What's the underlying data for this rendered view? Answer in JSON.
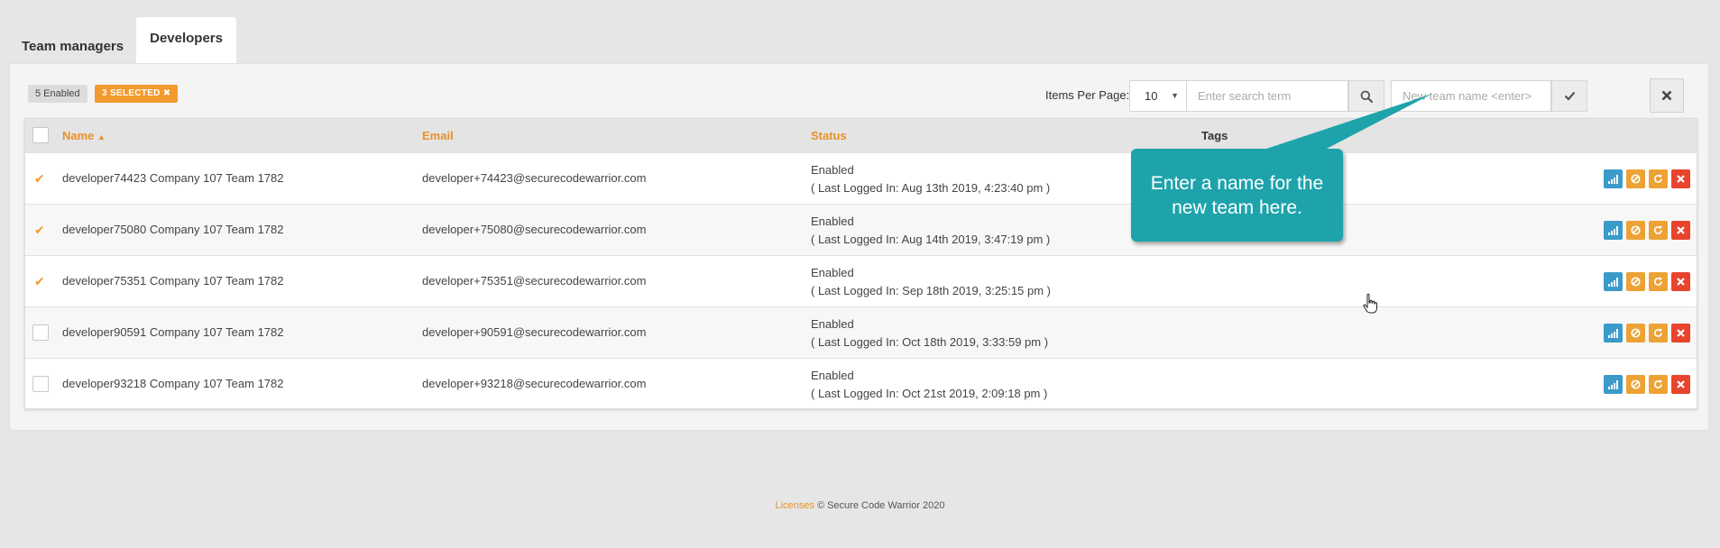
{
  "tabs": [
    {
      "label": "Team managers",
      "active": false
    },
    {
      "label": "Developers",
      "active": true
    }
  ],
  "toolbar": {
    "enabled_badge": "5 Enabled",
    "selected_badge": "3 SELECTED",
    "selected_badge_icon": "times-icon",
    "items_per_page_label": "Items Per Page:",
    "items_per_page_value": "10",
    "search_placeholder": "Enter search term",
    "team_name_placeholder": "New team name <enter>"
  },
  "table": {
    "columns": [
      "Name",
      "Email",
      "Status",
      "Tags"
    ],
    "sort_column": "Name",
    "sort_direction": "ascending",
    "rows": [
      {
        "selected": true,
        "name": "developer74423 Company 107 Team 1782",
        "email": "developer+74423@securecodewarrior.com",
        "status": "Enabled",
        "last_login": "( Last Logged In: Aug 13th 2019, 4:23:40 pm )",
        "tags": ""
      },
      {
        "selected": true,
        "name": "developer75080 Company 107 Team 1782",
        "email": "developer+75080@securecodewarrior.com",
        "status": "Enabled",
        "last_login": "( Last Logged In: Aug 14th 2019, 3:47:19 pm )",
        "tags": ""
      },
      {
        "selected": true,
        "name": "developer75351 Company 107 Team 1782",
        "email": "developer+75351@securecodewarrior.com",
        "status": "Enabled",
        "last_login": "( Last Logged In: Sep 18th 2019, 3:25:15 pm )",
        "tags": ""
      },
      {
        "selected": false,
        "name": "developer90591 Company 107 Team 1782",
        "email": "developer+90591@securecodewarrior.com",
        "status": "Enabled",
        "last_login": "( Last Logged In: Oct 18th 2019, 3:33:59 pm )",
        "tags": ""
      },
      {
        "selected": false,
        "name": "developer93218 Company 107 Team 1782",
        "email": "developer+93218@securecodewarrior.com",
        "status": "Enabled",
        "last_login": "( Last Logged In: Oct 21st 2019, 2:09:18 pm )",
        "tags": ""
      }
    ],
    "row_actions": [
      "stats-icon",
      "ban-icon",
      "refresh-icon",
      "times-icon"
    ]
  },
  "callout": {
    "text": "Enter a name for the new team here."
  },
  "footer": {
    "licenses_link": "Licenses",
    "copyright": "© Secure Code Warrior 2020"
  },
  "colors": {
    "accent_orange": "#f29a2e",
    "callout_teal": "#1ea3ab",
    "action_blue": "#3a9bc9",
    "action_red": "#e8442e"
  }
}
